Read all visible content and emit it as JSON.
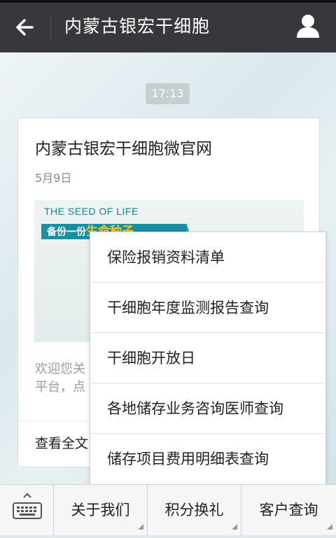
{
  "header": {
    "title": "内蒙古银宏干细胞",
    "back_icon": "back-arrow-icon",
    "user_icon": "user-profile-icon",
    "bg_color": "#36383b"
  },
  "chat": {
    "timestamp": "17:13",
    "card": {
      "title": "内蒙古银宏干细胞微官网",
      "date": "5月9日",
      "banner_text": "THE SEED  OF LIFE",
      "banner_strip_prefix": "备份一份",
      "banner_strip_highlight": "生命种子",
      "banner_chevrons": "》",
      "summary_line1": "欢迎您关",
      "summary_line2": "平台，点",
      "read_more": "查看全文"
    }
  },
  "menu": {
    "items": [
      {
        "label": "保险报销资料清单"
      },
      {
        "label": "干细胞年度监测报告查询"
      },
      {
        "label": "干细胞开放日"
      },
      {
        "label": "各地储存业务咨询医师查询"
      },
      {
        "label": "储存项目费用明细表查询"
      }
    ]
  },
  "bottom_bar": {
    "keyboard_icon": "keyboard-icon",
    "tabs": [
      {
        "label": "关于我们"
      },
      {
        "label": "积分换礼"
      },
      {
        "label": "客户查询"
      }
    ]
  }
}
